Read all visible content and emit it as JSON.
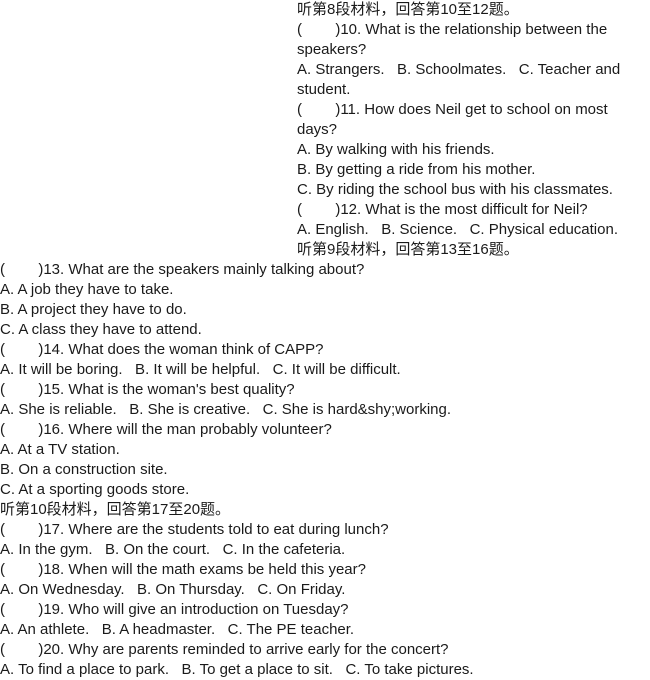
{
  "document": {
    "type": "listening-comprehension-exam",
    "language_mix": "zh-CN + en",
    "text_color": "#1a1a1a",
    "background_color": "#ffffff"
  },
  "sections": [
    {
      "id": "section-8",
      "heading": "听第8段材料，回答第10至12题。",
      "items": [
        {
          "marker": "(        )10.",
          "question": "What is the relationship between the speakers?"
        },
        {
          "options_inline": "A. Strangers.   B. Schoolmates.   C. Teacher and student."
        },
        {
          "marker": "(        )11.",
          "question": "How does Neil get to school on most days?"
        },
        {
          "option_a": "A. By walking with his friends."
        },
        {
          "option_b": "B. By getting a ride from his mother."
        },
        {
          "option_c": "C. By riding the school bus with his classmates."
        },
        {
          "marker": "(        )12.",
          "question": "What is the most difficult for Neil?"
        },
        {
          "options_inline": "A. English.   B. Science.   C. Physical education."
        }
      ]
    },
    {
      "id": "section-9",
      "heading": "听第9段材料，回答第13至16题。",
      "items": [
        {
          "marker": "(        )13.",
          "question": "What are the speakers mainly talking about?"
        },
        {
          "option_a": "A. A job they have to take."
        },
        {
          "option_b": "B. A project they have to do."
        },
        {
          "option_c": "C. A class they have to attend."
        },
        {
          "marker": "(        )14.",
          "question": "What does the woman think of CAPP?"
        },
        {
          "options_inline": "A. It will be boring.   B. It will be helpful.   C. It will be difficult."
        },
        {
          "marker": "(        )15.",
          "question": "What is the woman's best quality?"
        },
        {
          "options_inline": "A. She is reliable.   B. She is creative.   C. She is hard&shy;working."
        },
        {
          "marker": "(        )16.",
          "question": "Where will the man probably volunteer?"
        },
        {
          "option_a": "A. At a TV station."
        },
        {
          "option_b": "B. On a construction site."
        },
        {
          "option_c": "C. At a sporting goods store."
        }
      ]
    },
    {
      "id": "section-10",
      "heading": "听第10段材料，回答第17至20题。",
      "items": [
        {
          "marker": "(        )17.",
          "question": "Where are the students told to eat during lunch?"
        },
        {
          "options_inline": "A. In the gym.   B. On the court.   C. In the cafeteria."
        },
        {
          "marker": "(        )18.",
          "question": "When will the math exams be held this year?"
        },
        {
          "options_inline": "A. On Wednesday.   B. On Thursday.   C. On Friday."
        },
        {
          "marker": "(        )19.",
          "question": "Who will give an introduction on Tuesday?"
        },
        {
          "options_inline": "A. An athlete.   B. A headmaster.   C. The PE teacher."
        },
        {
          "marker": "(        )20.",
          "question": "Why are parents reminded to arrive early for the concert?"
        },
        {
          "options_inline": "A. To find a place to park.   B. To get a place to sit.   C. To take pictures."
        }
      ]
    }
  ],
  "lines": {
    "l01": "听第8段材料，回答第10至12题。",
    "l02": "(        )10. What is the relationship between the speakers?",
    "l03": "A. Strangers.   B. Schoolmates.   C. Teacher and student.",
    "l04": "(        )11. How does Neil get to school on most days?",
    "l05": "A. By walking with his friends.",
    "l06": "B. By getting a ride from his mother.",
    "l07": "C. By riding the school bus with his classmates.",
    "l08": "(        )12. What is the most difficult for Neil?",
    "l09": "A. English.   B. Science.   C. Physical education.",
    "l10": "听第9段材料，回答第13至16题。",
    "l11": "(        )13. What are the speakers mainly talking about?",
    "l12": "A. A job they have to take.",
    "l13": "B. A project they have to do.",
    "l14": "C. A class they have to attend.",
    "l15": "(        )14. What does the woman think of CAPP?",
    "l16": "A. It will be boring.   B. It will be helpful.   C. It will be difficult.",
    "l17": "(        )15. What is the woman's best quality?",
    "l18": "A. She is reliable.   B. She is creative.   C. She is hard&shy;working.",
    "l19": "(        )16. Where will the man probably volunteer?",
    "l20": "A. At a TV station.",
    "l21": "B. On a construction site.",
    "l22": "C. At a sporting goods store.",
    "l23": "听第10段材料，回答第17至20题。",
    "l24": "(        )17. Where are the students told to eat during lunch?",
    "l25": "A. In the gym.   B. On the court.   C. In the cafeteria.",
    "l26": "(        )18. When will the math exams be held this year?",
    "l27": "A. On Wednesday.   B. On Thursday.   C. On Friday.",
    "l28": "(        )19. Who will give an introduction on Tuesday?",
    "l29": "A. An athlete.   B. A headmaster.   C. The PE teacher.",
    "l30": "(        )20. Why are parents reminded to arrive early for the concert?",
    "l31": "A. To find a place to park.   B. To get a place to sit.   C. To take pictures."
  }
}
